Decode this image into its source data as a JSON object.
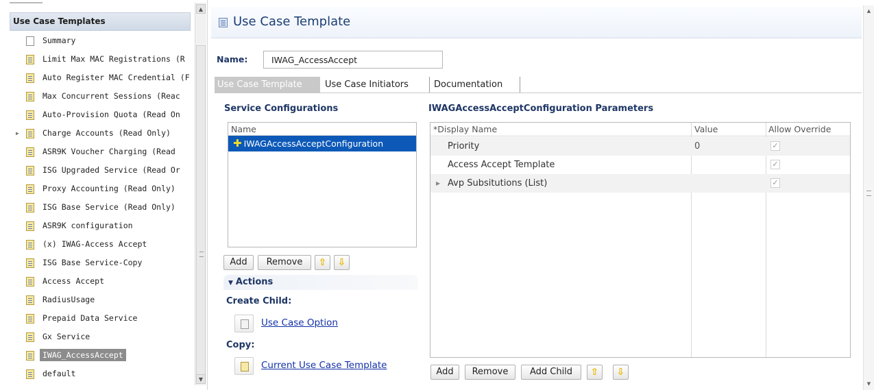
{
  "left_panel": {
    "header": "Use Case Templates",
    "items": [
      {
        "label": "Summary",
        "icon": "page-icon",
        "expandable": false,
        "selected": false
      },
      {
        "label": "Limit Max MAC Registrations (R",
        "icon": "template-icon",
        "expandable": false,
        "selected": false
      },
      {
        "label": "Auto Register MAC Credential (F",
        "icon": "template-icon",
        "expandable": false,
        "selected": false
      },
      {
        "label": "Max Concurrent Sessions (Reac",
        "icon": "template-icon",
        "expandable": false,
        "selected": false
      },
      {
        "label": "Auto-Provision Quota (Read On",
        "icon": "template-icon",
        "expandable": false,
        "selected": false
      },
      {
        "label": "Charge Accounts (Read Only)",
        "icon": "template-icon",
        "expandable": true,
        "selected": false
      },
      {
        "label": "ASR9K Voucher Charging (Read",
        "icon": "template-icon",
        "expandable": false,
        "selected": false
      },
      {
        "label": "ISG Upgraded Service (Read Or",
        "icon": "template-icon",
        "expandable": false,
        "selected": false
      },
      {
        "label": "Proxy Accounting (Read Only)",
        "icon": "template-icon",
        "expandable": false,
        "selected": false
      },
      {
        "label": "ISG Base Service (Read Only)",
        "icon": "template-icon",
        "expandable": false,
        "selected": false
      },
      {
        "label": "ASR9K configuration",
        "icon": "template-icon",
        "expandable": false,
        "selected": false
      },
      {
        "label": "(x) IWAG-Access Accept",
        "icon": "template-icon",
        "expandable": false,
        "selected": false
      },
      {
        "label": "ISG Base Service-Copy",
        "icon": "template-icon",
        "expandable": false,
        "selected": false
      },
      {
        "label": "Access Accept",
        "icon": "template-icon",
        "expandable": false,
        "selected": false
      },
      {
        "label": "RadiusUsage",
        "icon": "template-icon",
        "expandable": false,
        "selected": false
      },
      {
        "label": "Prepaid Data Service",
        "icon": "template-icon",
        "expandable": false,
        "selected": false
      },
      {
        "label": "Gx Service",
        "icon": "template-icon",
        "expandable": false,
        "selected": false
      },
      {
        "label": "IWAG_AccessAccept",
        "icon": "template-icon",
        "expandable": false,
        "selected": true
      },
      {
        "label": "default",
        "icon": "template-icon",
        "expandable": false,
        "selected": false
      }
    ]
  },
  "editor": {
    "title": "Use Case Template",
    "name_label": "Name:",
    "name_value": "IWAG_AccessAccept",
    "tabs": [
      {
        "label": "Use Case Template",
        "active": true
      },
      {
        "label": "Use Case Initiators",
        "active": false
      },
      {
        "label": "Documentation",
        "active": false
      }
    ],
    "service_configurations": {
      "heading": "Service Configurations",
      "column": "Name",
      "rows": [
        "IWAGAccessAcceptConfiguration"
      ],
      "buttons": {
        "add": "Add",
        "remove": "Remove",
        "up": "⇧",
        "down": "⇩"
      }
    },
    "actions": {
      "heading": "Actions",
      "create_child_label": "Create Child:",
      "create_child_link": "Use Case Option",
      "copy_label": "Copy:",
      "copy_link": "Current Use Case Template"
    },
    "parameters": {
      "heading": "IWAGAccessAcceptConfiguration Parameters",
      "columns": [
        "*Display Name",
        "Value",
        "Allow Override"
      ],
      "rows": [
        {
          "name": "Priority",
          "value": "0",
          "allow_override": true,
          "expandable": false
        },
        {
          "name": "Access Accept Template",
          "value": "",
          "allow_override": true,
          "expandable": false
        },
        {
          "name": "Avp Subsitutions (List)",
          "value": "",
          "allow_override": true,
          "expandable": true
        }
      ],
      "buttons": {
        "add": "Add",
        "remove": "Remove",
        "add_child": "Add Child",
        "up": "⇧",
        "down": "⇩"
      }
    }
  },
  "glyphs": {
    "check": "✓",
    "plus": "✚",
    "caret_down": "▼",
    "caret_right": "▶",
    "scroll_up": "▲",
    "scroll_down": "▼"
  },
  "colors": {
    "selection": "#0c59b8",
    "heading": "#1e3665",
    "link": "#1230a8",
    "tree_selected": "#8c8c8c"
  }
}
